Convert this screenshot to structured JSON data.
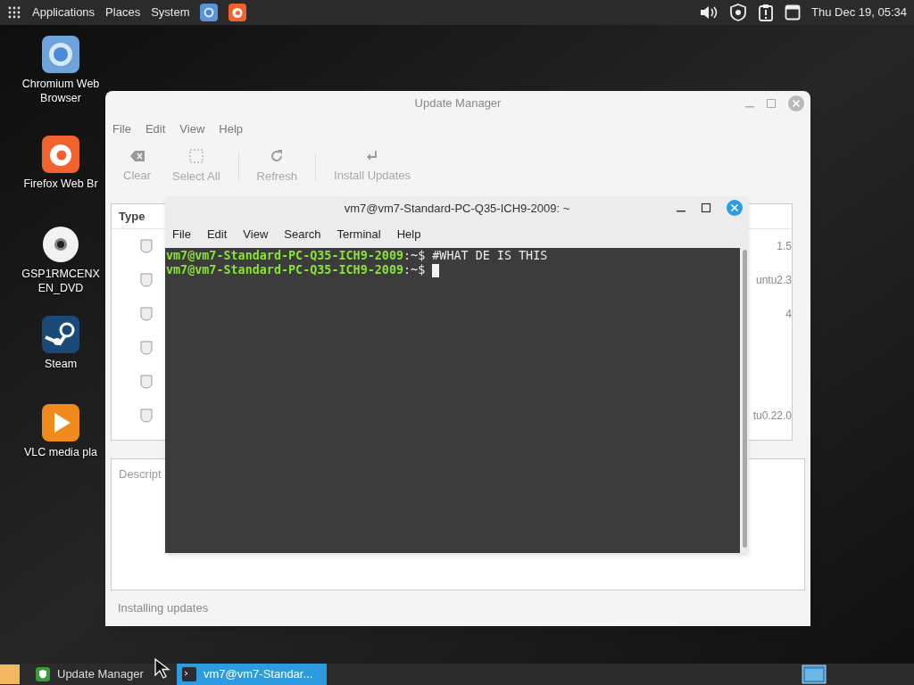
{
  "top_panel": {
    "menus": [
      "Applications",
      "Places",
      "System"
    ],
    "clock": "Thu Dec 19, 05:34"
  },
  "desktop_icons": [
    {
      "kind": "chromium",
      "label": "Chromium Web Browser"
    },
    {
      "kind": "firefox",
      "label": "Firefox Web Br"
    },
    {
      "kind": "disc",
      "label": "GSP1RMCENX EN_DVD"
    },
    {
      "kind": "steam",
      "label": "Steam"
    },
    {
      "kind": "vlc",
      "label": "VLC media pla"
    }
  ],
  "update_manager": {
    "title": "Update Manager",
    "menu": [
      "File",
      "Edit",
      "View",
      "Help"
    ],
    "toolbar": [
      {
        "kind": "clear",
        "label": "Clear",
        "disabled": true
      },
      {
        "kind": "select",
        "label": "Select All",
        "disabled": true
      },
      {
        "kind": "refresh",
        "label": "Refresh",
        "disabled": true
      },
      {
        "kind": "install",
        "label": "Install Updates",
        "disabled": true
      }
    ],
    "column_header": "Type",
    "rows": [
      {
        "version": "1.5"
      },
      {
        "version": "untu2.3"
      },
      {
        "version": "4"
      },
      {},
      {},
      {
        "version": "tu0.22.0"
      }
    ],
    "description_label": "Descript",
    "status": "Installing updates"
  },
  "terminal": {
    "title": "vm7@vm7-Standard-PC-Q35-ICH9-2009: ~",
    "menu": [
      "File",
      "Edit",
      "View",
      "Search",
      "Terminal",
      "Help"
    ],
    "lines": [
      {
        "prompt": "vm7@vm7-Standard-PC-Q35-ICH9-2009",
        "path": ":~$ ",
        "command": "#WHAT DE IS THIS",
        "cursor": false
      },
      {
        "prompt": "vm7@vm7-Standard-PC-Q35-ICH9-2009",
        "path": ":~$ ",
        "cursor": true
      }
    ]
  },
  "taskbar": {
    "items": [
      {
        "kind": "update",
        "label": "Update Manager",
        "selected": false
      },
      {
        "kind": "terminal",
        "label": "vm7@vm7-Standar...",
        "selected": true
      }
    ]
  }
}
